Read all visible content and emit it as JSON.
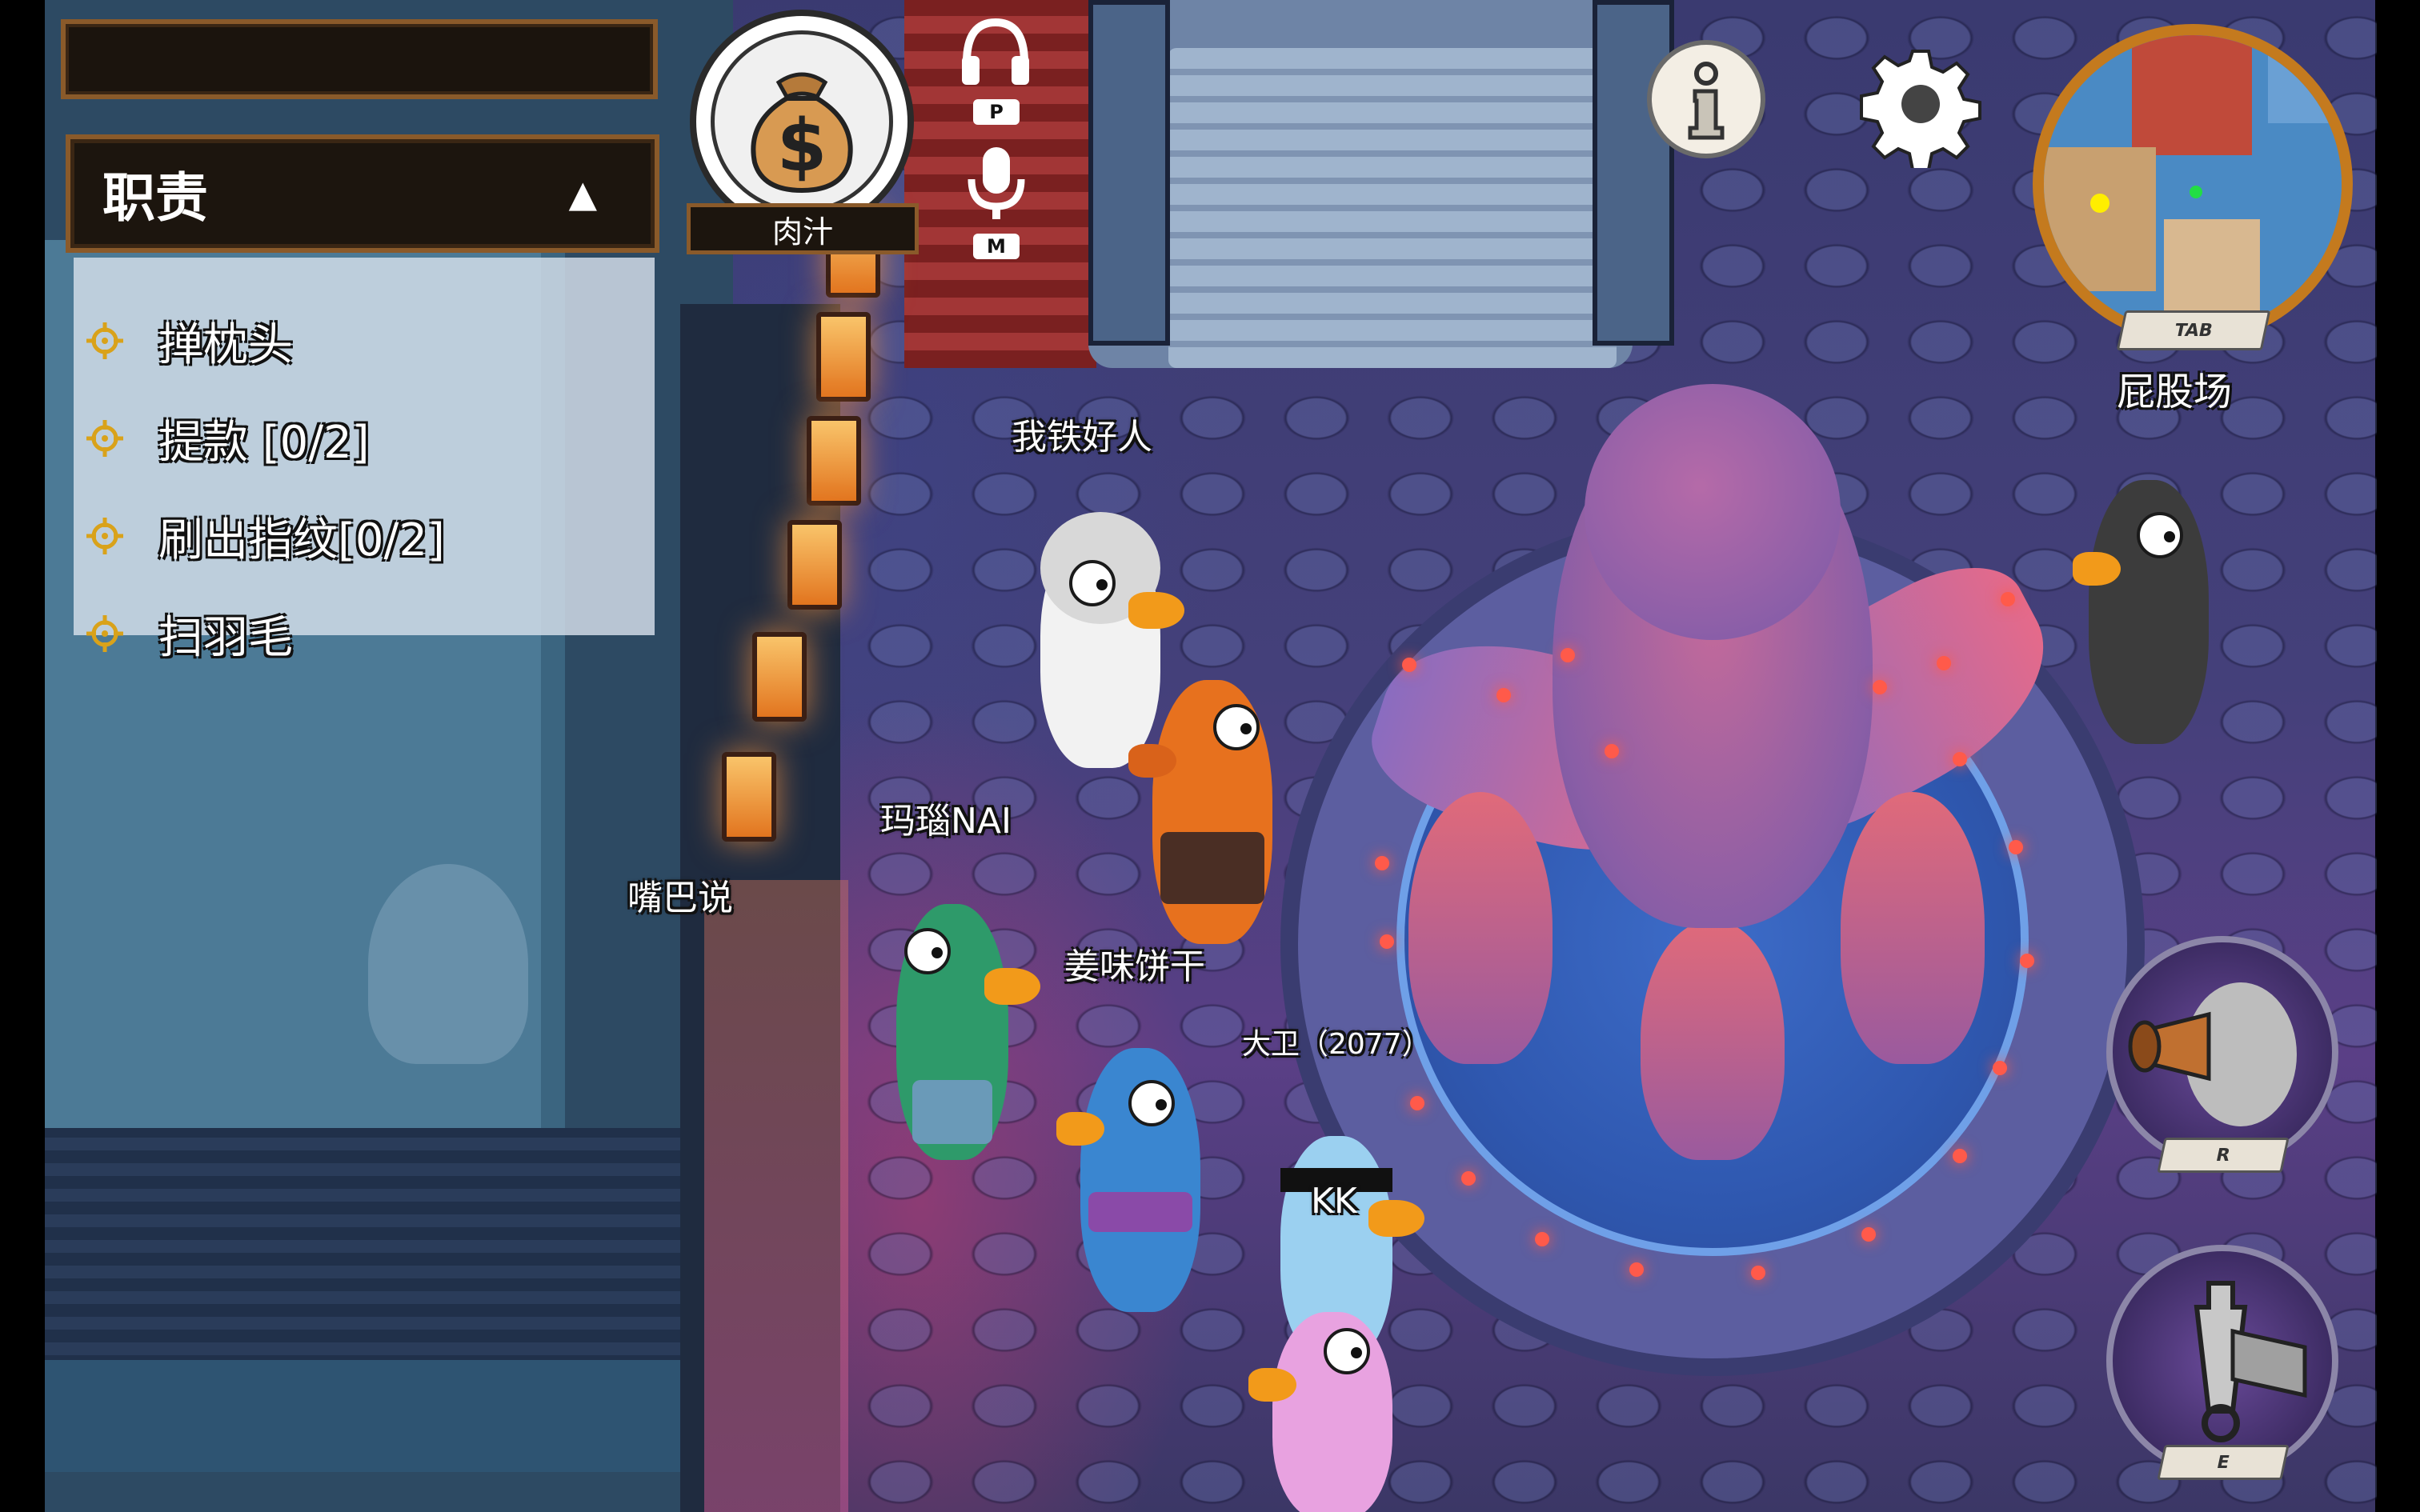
{
  "hud": {
    "top_input_value": "",
    "duty_panel": {
      "title": "职责",
      "toggle_glyph": "▲",
      "tasks": [
        {
          "label": "掸枕头",
          "icon": "target-icon"
        },
        {
          "label": "提款 [0/2]",
          "icon": "target-icon"
        },
        {
          "label": "刷出指纹[0/2]",
          "icon": "target-icon"
        },
        {
          "label": "扫羽毛",
          "icon": "target-icon"
        }
      ]
    },
    "role": {
      "name": "肉汁",
      "icon": "money-bag-icon",
      "symbol": "$"
    },
    "voice": {
      "headphones_key": "P",
      "mic_key": "M"
    },
    "minimap_key": "TAB",
    "location": "屁股场",
    "abilities": [
      {
        "key": "R",
        "icon": "horn-icon"
      },
      {
        "key": "E",
        "icon": "wrench-icon"
      }
    ]
  },
  "players": [
    {
      "name": "我铁好人"
    },
    {
      "name": "玛瑙NAI"
    },
    {
      "name": "嘴巴说"
    },
    {
      "name": "姜味饼干"
    },
    {
      "name": "大卫（2077）"
    },
    {
      "name": "KK"
    }
  ],
  "colors": {
    "panel_border": "#8a5a2a",
    "panel_bg": "#1c150e",
    "task_icon": "#d9a21a",
    "minimap_ring": "#c47a1e"
  }
}
